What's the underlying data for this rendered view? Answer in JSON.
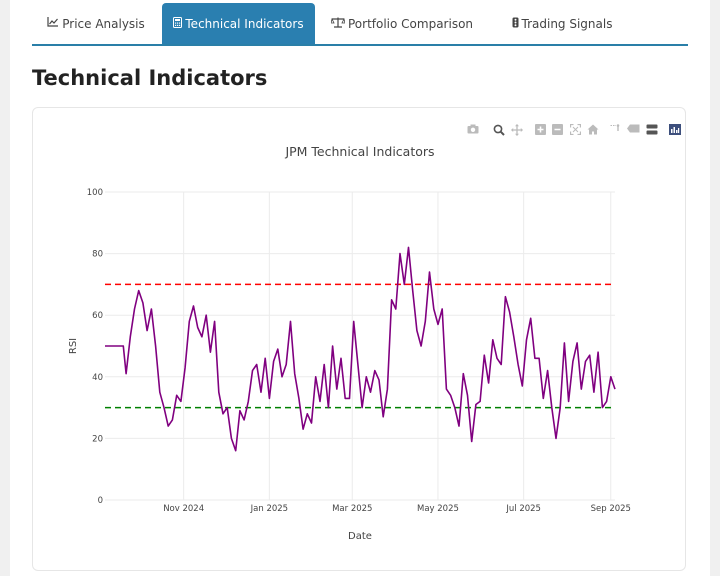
{
  "tabs": [
    {
      "label": "Price Analysis",
      "icon": "chart-line-icon",
      "glyph": "📈"
    },
    {
      "label": "Technical Indicators",
      "icon": "calculator-icon",
      "glyph": "▦"
    },
    {
      "label": "Portfolio Comparison",
      "icon": "balance-scale-icon",
      "glyph": "⚖"
    },
    {
      "label": "Trading Signals",
      "icon": "traffic-light-icon",
      "glyph": "▮"
    }
  ],
  "active_tab": 1,
  "section_title": "Technical Indicators",
  "modebar": [
    "camera-icon",
    "zoom-icon",
    "pan-icon",
    "zoom-in-icon",
    "zoom-out-icon",
    "autoscale-icon",
    "reset-axes-icon",
    "spike-lines-icon",
    "hover-closest-icon",
    "hover-compare-icon",
    "plotly-logo-icon"
  ],
  "colors": {
    "accent": "#2a7fb0",
    "rsi_line": "#800080",
    "overbought": "#ff0000",
    "oversold": "#008000"
  },
  "chart_data": {
    "type": "line",
    "title": "JPM Technical Indicators",
    "xlabel": "Date",
    "ylabel": "RSI",
    "ylim": [
      0,
      100
    ],
    "yticks": [
      0,
      20,
      40,
      60,
      80,
      100
    ],
    "xticks": [
      {
        "date": "2024-11-01",
        "label": "Nov 2024"
      },
      {
        "date": "2025-01-01",
        "label": "Jan 2025"
      },
      {
        "date": "2025-03-01",
        "label": "Mar 2025"
      },
      {
        "date": "2025-05-01",
        "label": "May 2025"
      },
      {
        "date": "2025-07-01",
        "label": "Jul 2025"
      },
      {
        "date": "2025-09-01",
        "label": "Sep 2025"
      }
    ],
    "xlim": [
      "2024-09-06",
      "2025-09-04"
    ],
    "grid": true,
    "legend": "none",
    "hlines": [
      {
        "value": 70,
        "color": "#ff0000",
        "dash": true
      },
      {
        "value": 30,
        "color": "#008000",
        "dash": true
      }
    ],
    "series": [
      {
        "color": "#800080",
        "x": [
          "2024-09-06",
          "2024-09-13",
          "2024-09-19",
          "2024-09-21",
          "2024-09-24",
          "2024-09-27",
          "2024-09-30",
          "2024-10-03",
          "2024-10-06",
          "2024-10-09",
          "2024-10-12",
          "2024-10-15",
          "2024-10-18",
          "2024-10-21",
          "2024-10-24",
          "2024-10-27",
          "2024-10-30",
          "2024-11-02",
          "2024-11-05",
          "2024-11-08",
          "2024-11-11",
          "2024-11-14",
          "2024-11-17",
          "2024-11-20",
          "2024-11-23",
          "2024-11-26",
          "2024-11-29",
          "2024-12-02",
          "2024-12-05",
          "2024-12-08",
          "2024-12-11",
          "2024-12-14",
          "2024-12-17",
          "2024-12-20",
          "2024-12-23",
          "2024-12-26",
          "2024-12-29",
          "2025-01-01",
          "2025-01-04",
          "2025-01-07",
          "2025-01-10",
          "2025-01-13",
          "2025-01-16",
          "2025-01-19",
          "2025-01-22",
          "2025-01-25",
          "2025-01-28",
          "2025-01-31",
          "2025-02-03",
          "2025-02-06",
          "2025-02-09",
          "2025-02-12",
          "2025-02-15",
          "2025-02-18",
          "2025-02-21",
          "2025-02-24",
          "2025-02-27",
          "2025-03-02",
          "2025-03-05",
          "2025-03-08",
          "2025-03-11",
          "2025-03-14",
          "2025-03-17",
          "2025-03-20",
          "2025-03-23",
          "2025-03-26",
          "2025-03-29",
          "2025-04-01",
          "2025-04-04",
          "2025-04-07",
          "2025-04-10",
          "2025-04-13",
          "2025-04-16",
          "2025-04-19",
          "2025-04-22",
          "2025-04-25",
          "2025-04-28",
          "2025-05-01",
          "2025-05-04",
          "2025-05-07",
          "2025-05-10",
          "2025-05-13",
          "2025-05-16",
          "2025-05-19",
          "2025-05-22",
          "2025-05-25",
          "2025-05-28",
          "2025-05-31",
          "2025-06-03",
          "2025-06-06",
          "2025-06-09",
          "2025-06-12",
          "2025-06-15",
          "2025-06-18",
          "2025-06-21",
          "2025-06-24",
          "2025-06-27",
          "2025-06-30",
          "2025-07-03",
          "2025-07-06",
          "2025-07-09",
          "2025-07-12",
          "2025-07-15",
          "2025-07-18",
          "2025-07-21",
          "2025-07-24",
          "2025-07-27",
          "2025-07-30",
          "2025-08-02",
          "2025-08-05",
          "2025-08-08",
          "2025-08-11",
          "2025-08-14",
          "2025-08-17",
          "2025-08-20",
          "2025-08-23",
          "2025-08-26",
          "2025-08-29",
          "2025-09-01",
          "2025-09-04"
        ],
        "values": [
          50,
          50,
          50,
          41,
          53,
          62,
          68,
          64,
          55,
          62,
          50,
          35,
          30,
          24,
          26,
          34,
          32,
          43,
          58,
          63,
          56,
          53,
          60,
          48,
          58,
          35,
          28,
          30,
          20,
          16,
          29,
          26,
          32,
          42,
          44,
          35,
          46,
          33,
          45,
          49,
          40,
          44,
          58,
          41,
          33,
          23,
          28,
          25,
          40,
          32,
          44,
          30,
          50,
          36,
          46,
          33,
          33,
          58,
          44,
          30,
          40,
          35,
          42,
          39,
          27,
          36,
          65,
          62,
          80,
          70,
          82,
          68,
          55,
          50,
          58,
          74,
          62,
          57,
          62,
          36,
          34,
          30,
          24,
          41,
          34,
          19,
          31,
          32,
          47,
          38,
          52,
          46,
          44,
          66,
          61,
          53,
          44,
          37,
          52,
          59,
          46,
          46,
          33,
          42,
          30,
          20,
          30,
          51,
          32,
          45,
          51,
          36,
          45,
          47,
          35,
          48,
          30,
          32,
          40,
          36
        ]
      }
    ]
  }
}
